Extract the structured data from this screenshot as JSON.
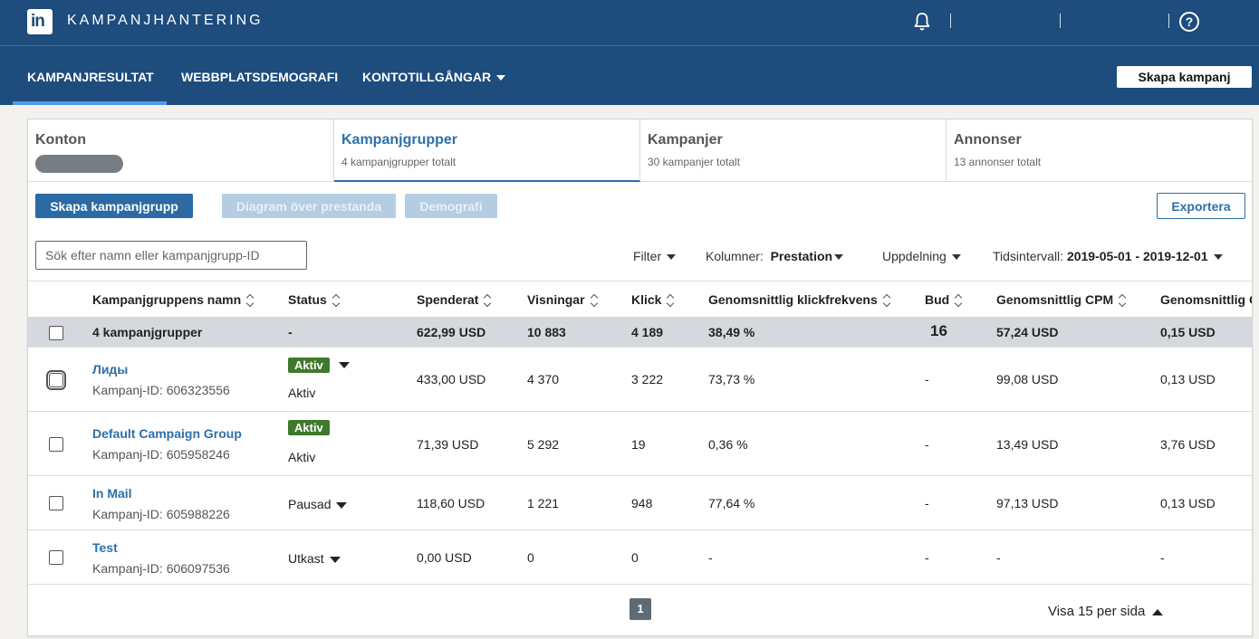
{
  "app": {
    "logo_text": "in",
    "title": "KAMPANJHANTERING",
    "help_glyph": "?"
  },
  "nav": {
    "items": [
      "KAMPANJRESULTAT",
      "WEBBPLATSDEMOGRAFI",
      "KONTOTILLGÅNGAR"
    ],
    "create_campaign": "Skapa kampanj"
  },
  "tabs": [
    {
      "title": "Konton",
      "subtitle": ""
    },
    {
      "title": "Kampanjgrupper",
      "subtitle": "4 kampanjgrupper totalt"
    },
    {
      "title": "Kampanjer",
      "subtitle": "30 kampanjer totalt"
    },
    {
      "title": "Annonser",
      "subtitle": "13 annonser totalt"
    }
  ],
  "toolbar": {
    "create_group": "Skapa kampanjgrupp",
    "performance_chart": "Diagram över prestanda",
    "demographics": "Demografi",
    "export": "Exportera",
    "search_placeholder": "Sök efter namn eller kampanjgrupp-ID",
    "filter": "Filter",
    "columns_label": "Kolumner:",
    "columns_value": "Prestation",
    "breakdown": "Uppdelning",
    "time_label": "Tidsintervall:",
    "time_value": "2019-05-01 - 2019-12-01"
  },
  "table": {
    "headers": [
      "Kampanjgruppens namn",
      "Status",
      "Spenderat",
      "Visningar",
      "Klick",
      "Genomsnittlig klickfrekvens",
      "Bud",
      "Genomsnittlig CPM",
      "Genomsnittlig C"
    ],
    "summary": [
      "4 kampanjgrupper",
      "-",
      "622,99 USD",
      "10 883",
      "4 189",
      "38,49 %",
      "16",
      "57,24 USD",
      "0,15 USD"
    ],
    "rows": [
      {
        "name": "Лиды",
        "id": "Kampanj-ID: 606323556",
        "badge": "Aktiv",
        "status": "Aktiv",
        "spent": "433,00 USD",
        "impressions": "4 370",
        "clicks": "3 222",
        "ctr": "73,73 %",
        "bid": "-",
        "cpm": "99,08 USD",
        "cpc": "0,13 USD"
      },
      {
        "name": "Default Campaign Group",
        "id": "Kampanj-ID: 605958246",
        "badge": "Aktiv",
        "status": "Aktiv",
        "spent": "71,39 USD",
        "impressions": "5 292",
        "clicks": "19",
        "ctr": "0,36 %",
        "bid": "-",
        "cpm": "13,49 USD",
        "cpc": "3,76 USD"
      },
      {
        "name": "In Mail",
        "id": "Kampanj-ID: 605988226",
        "status": "Pausad",
        "spent": "118,60 USD",
        "impressions": "1 221",
        "clicks": "948",
        "ctr": "77,64 %",
        "bid": "-",
        "cpm": "97,13 USD",
        "cpc": "0,13 USD"
      },
      {
        "name": "Test",
        "id": "Kampanj-ID: 606097536",
        "status": "Utkast",
        "spent": "0,00 USD",
        "impressions": "0",
        "clicks": "0",
        "ctr": "-",
        "bid": "-",
        "cpm": "-",
        "cpc": "-"
      }
    ]
  },
  "pagination": {
    "page": "1",
    "per_page": "Visa 15 per sida"
  },
  "colors": {
    "header_bg": "#1d4c7d",
    "accent": "#2d6fa9",
    "active_badge": "#3f7a2c"
  }
}
